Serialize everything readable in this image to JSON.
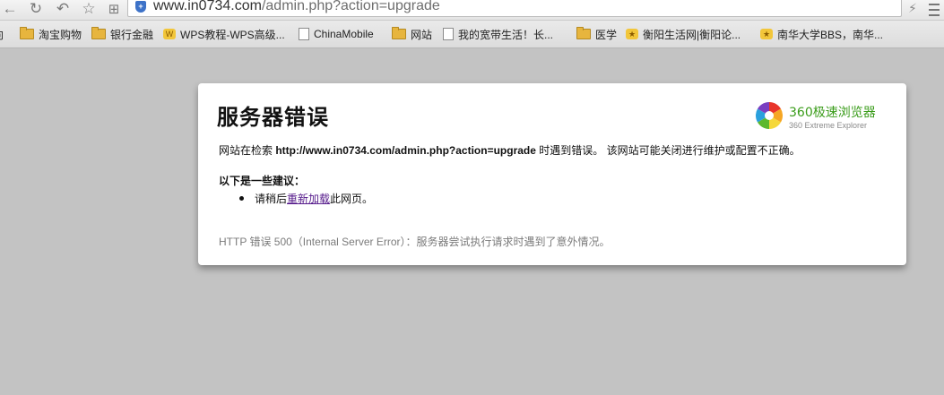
{
  "browser": {
    "address": {
      "host": "www.in0734.com",
      "path": "/admin.php?action=upgrade"
    },
    "bookmarks": [
      {
        "label": "淘宝购物",
        "icon": "folder-icon"
      },
      {
        "label": "银行金融",
        "icon": "folder-icon"
      },
      {
        "label": "WPS教程-WPS高级...",
        "icon": "wps-favicon-icon"
      },
      {
        "label": "ChinaMobile",
        "icon": "page-icon"
      },
      {
        "label": "网站",
        "icon": "folder-icon"
      },
      {
        "label": "我的宽带生活！长...",
        "icon": "page-icon"
      },
      {
        "label": "医学",
        "icon": "folder-icon"
      },
      {
        "label": "衡阳生活网|衡阳论...",
        "icon": "forum-favicon-icon"
      },
      {
        "label": "南华大学BBS，南华...",
        "icon": "forum-favicon-icon"
      }
    ]
  },
  "error": {
    "title": "服务器错误",
    "brand_name": "360极速浏览器",
    "brand_sub": "360 Extreme Explorer",
    "msg_prefix": "网站在检索 ",
    "msg_url": "http://www.in0734.com/admin.php?action=upgrade",
    "msg_suffix": " 时遇到错误。 该网站可能关闭进行维护或配置不正确。",
    "suggestions_title": "以下是一些建议：",
    "suggestion_prefix": "请稍后",
    "suggestion_link": "重新加载",
    "suggestion_suffix": "此网页。",
    "http_code_text": "HTTP 错误 500（Internal Server Error）：服务器尝试执行请求时遇到了意外情况。"
  },
  "colors": {
    "brand_green": "#3a9c1a",
    "link_visited": "#551a8b",
    "page_background": "#c3c3c3"
  }
}
